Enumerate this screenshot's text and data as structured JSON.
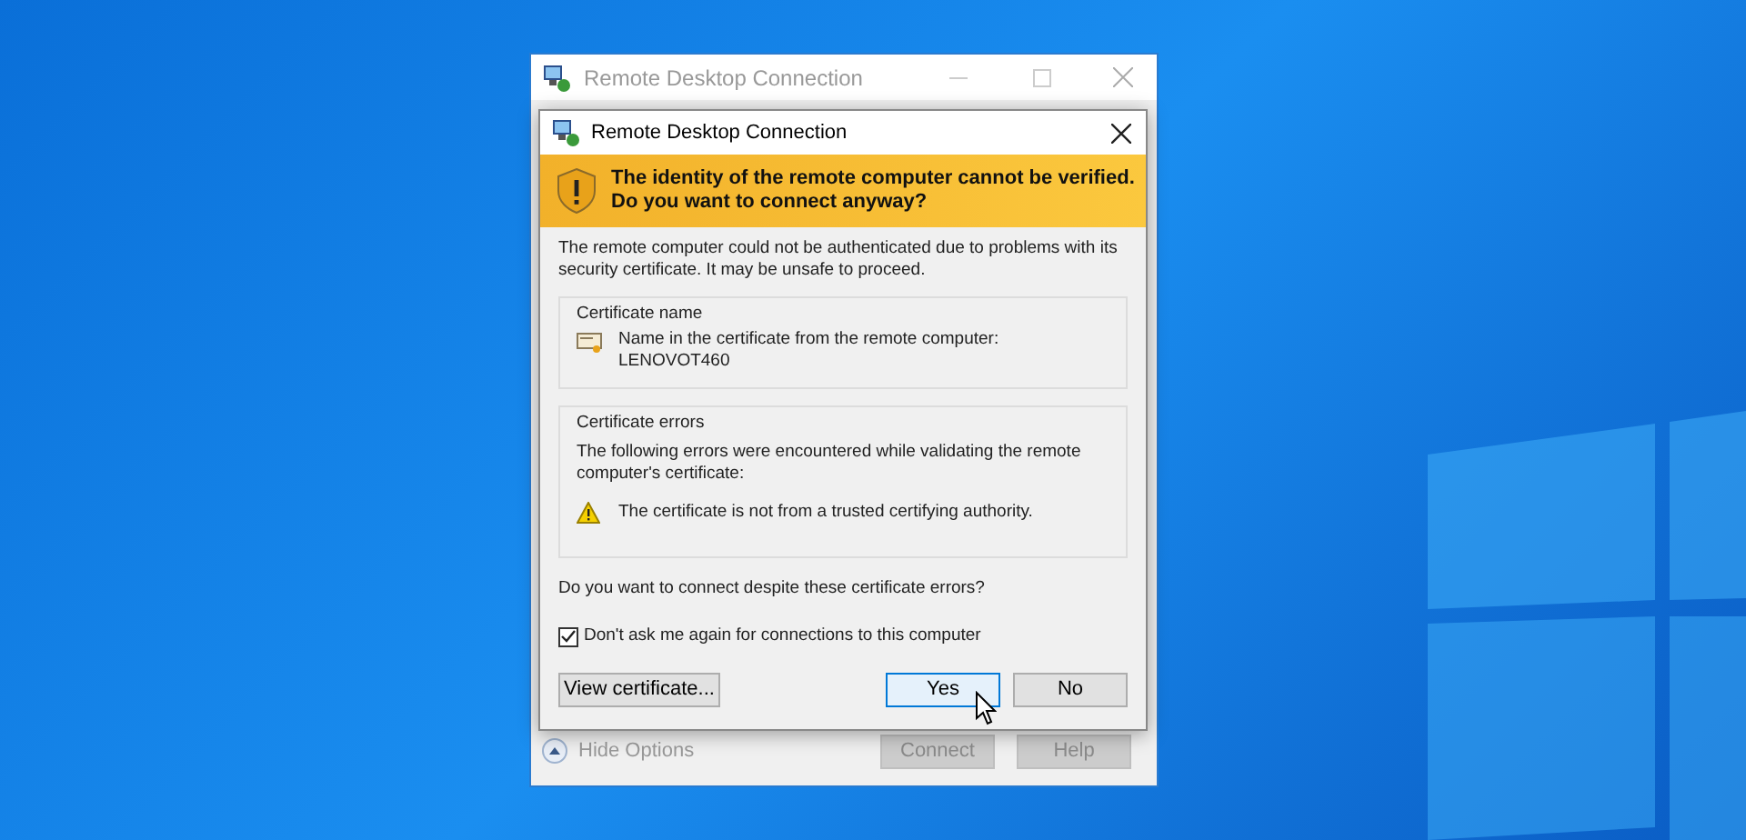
{
  "back_window": {
    "title": "Remote Desktop Connection",
    "options_toggle": "Hide Options",
    "buttons": [
      {
        "label": "Connect",
        "disabled": true
      },
      {
        "label": "Help",
        "disabled": true
      }
    ]
  },
  "dialog": {
    "title": "Remote Desktop Connection",
    "banner": "The identity of the remote computer cannot be verified. Do you want to connect anyway?",
    "intro": "The remote computer could not be authenticated due to problems with its security certificate. It may be unsafe to proceed.",
    "certificate_name": {
      "title": "Certificate name",
      "label": "Name in the certificate from the remote computer:",
      "value": "LENOVOT460"
    },
    "certificate_errors": {
      "title": "Certificate errors",
      "intro": "The following errors were encountered while validating the remote computer's certificate:",
      "errors": [
        "The certificate is not from a trusted certifying authority."
      ]
    },
    "question": "Do you want to connect despite these certificate errors?",
    "checkbox": {
      "label": "Don't ask me again for connections to this computer",
      "checked": true
    },
    "buttons": [
      {
        "label": "View certificate...",
        "selected": false
      },
      {
        "label": "Yes",
        "selected": true
      },
      {
        "label": "No",
        "selected": false
      }
    ]
  }
}
